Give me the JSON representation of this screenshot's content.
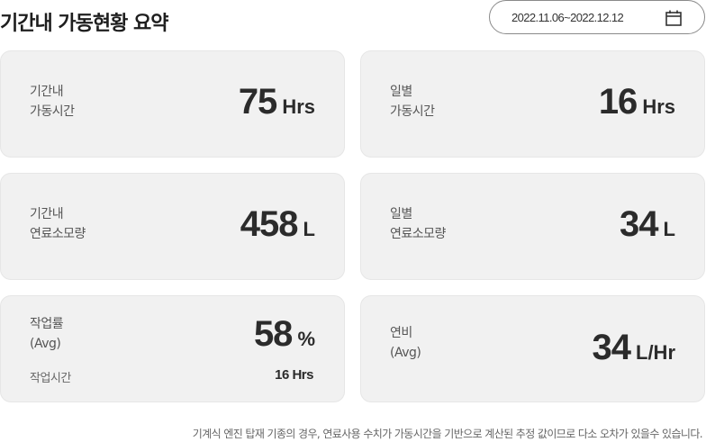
{
  "header": {
    "title": "기간내 가동현황 요약",
    "date_range": "2022.11.06~2022.12.12",
    "date_icon": "calendar-icon"
  },
  "cards": {
    "period_runtime": {
      "label": "기간내\n가동시간",
      "value": "75",
      "unit": "Hrs"
    },
    "daily_runtime": {
      "label": "일별\n가동시간",
      "value": "16",
      "unit": "Hrs"
    },
    "period_fuel": {
      "label": "기간내\n연료소모량",
      "value": "458",
      "unit": "L"
    },
    "daily_fuel": {
      "label": "일별\n연료소모량",
      "value": "34",
      "unit": "L"
    },
    "work_rate": {
      "label": "작업률\n(Avg)",
      "value": "58",
      "unit": "%",
      "sub_label": "작업시간",
      "sub_value": "16 Hrs"
    },
    "fuel_efficiency": {
      "label": "연비\n(Avg)",
      "value": "34",
      "unit": "L/Hr"
    }
  },
  "footnote": "기계식 엔진 탑재 기종의 경우, 연료사용 수치가 가동시간을 기반으로 계산된 추정 값이므로 다소 오차가 있을수 있습니다.",
  "colors": {
    "card_bg": "#f1f1f1",
    "text_dark": "#2b2b2b",
    "border": "#8a8a8a"
  }
}
